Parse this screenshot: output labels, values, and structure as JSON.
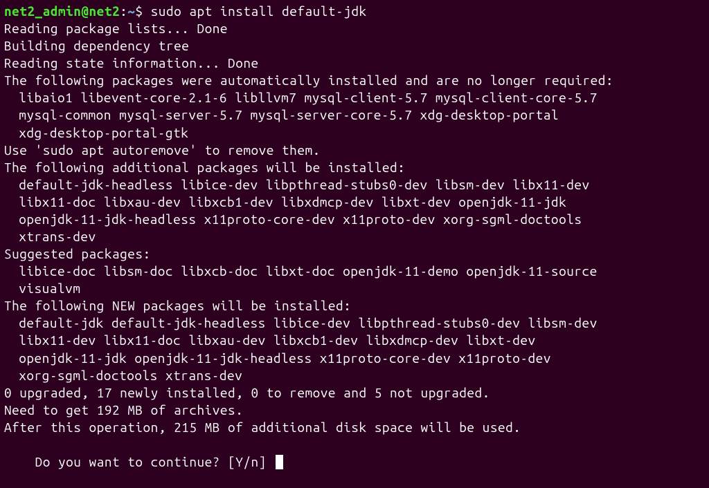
{
  "prompt": {
    "user_host": "net2_admin@net2",
    "sep1": ":",
    "path": "~",
    "sigil": "$ ",
    "command": "sudo apt install default-jdk"
  },
  "lines": {
    "l1": "Reading package lists... Done",
    "l2": "Building dependency tree",
    "l3": "Reading state information... Done",
    "l4": "The following packages were automatically installed and are no longer required:",
    "l5": "libaio1 libevent-core-2.1-6 libllvm7 mysql-client-5.7 mysql-client-core-5.7",
    "l6": "mysql-common mysql-server-5.7 mysql-server-core-5.7 xdg-desktop-portal",
    "l7": "xdg-desktop-portal-gtk",
    "l8": "Use 'sudo apt autoremove' to remove them.",
    "l9": "The following additional packages will be installed:",
    "l10": "default-jdk-headless libice-dev libpthread-stubs0-dev libsm-dev libx11-dev",
    "l11": "libx11-doc libxau-dev libxcb1-dev libxdmcp-dev libxt-dev openjdk-11-jdk",
    "l12": "openjdk-11-jdk-headless x11proto-core-dev x11proto-dev xorg-sgml-doctools",
    "l13": "xtrans-dev",
    "l14": "Suggested packages:",
    "l15": "libice-doc libsm-doc libxcb-doc libxt-doc openjdk-11-demo openjdk-11-source",
    "l16": "visualvm",
    "l17": "The following NEW packages will be installed:",
    "l18": "default-jdk default-jdk-headless libice-dev libpthread-stubs0-dev libsm-dev",
    "l19": "libx11-dev libx11-doc libxau-dev libxcb1-dev libxdmcp-dev libxt-dev",
    "l20": "openjdk-11-jdk openjdk-11-jdk-headless x11proto-core-dev x11proto-dev",
    "l21": "xorg-sgml-doctools xtrans-dev",
    "l22": "0 upgraded, 17 newly installed, 0 to remove and 5 not upgraded.",
    "l23": "Need to get 192 MB of archives.",
    "l24": "After this operation, 215 MB of additional disk space will be used.",
    "l25": "Do you want to continue? [Y/n] "
  }
}
